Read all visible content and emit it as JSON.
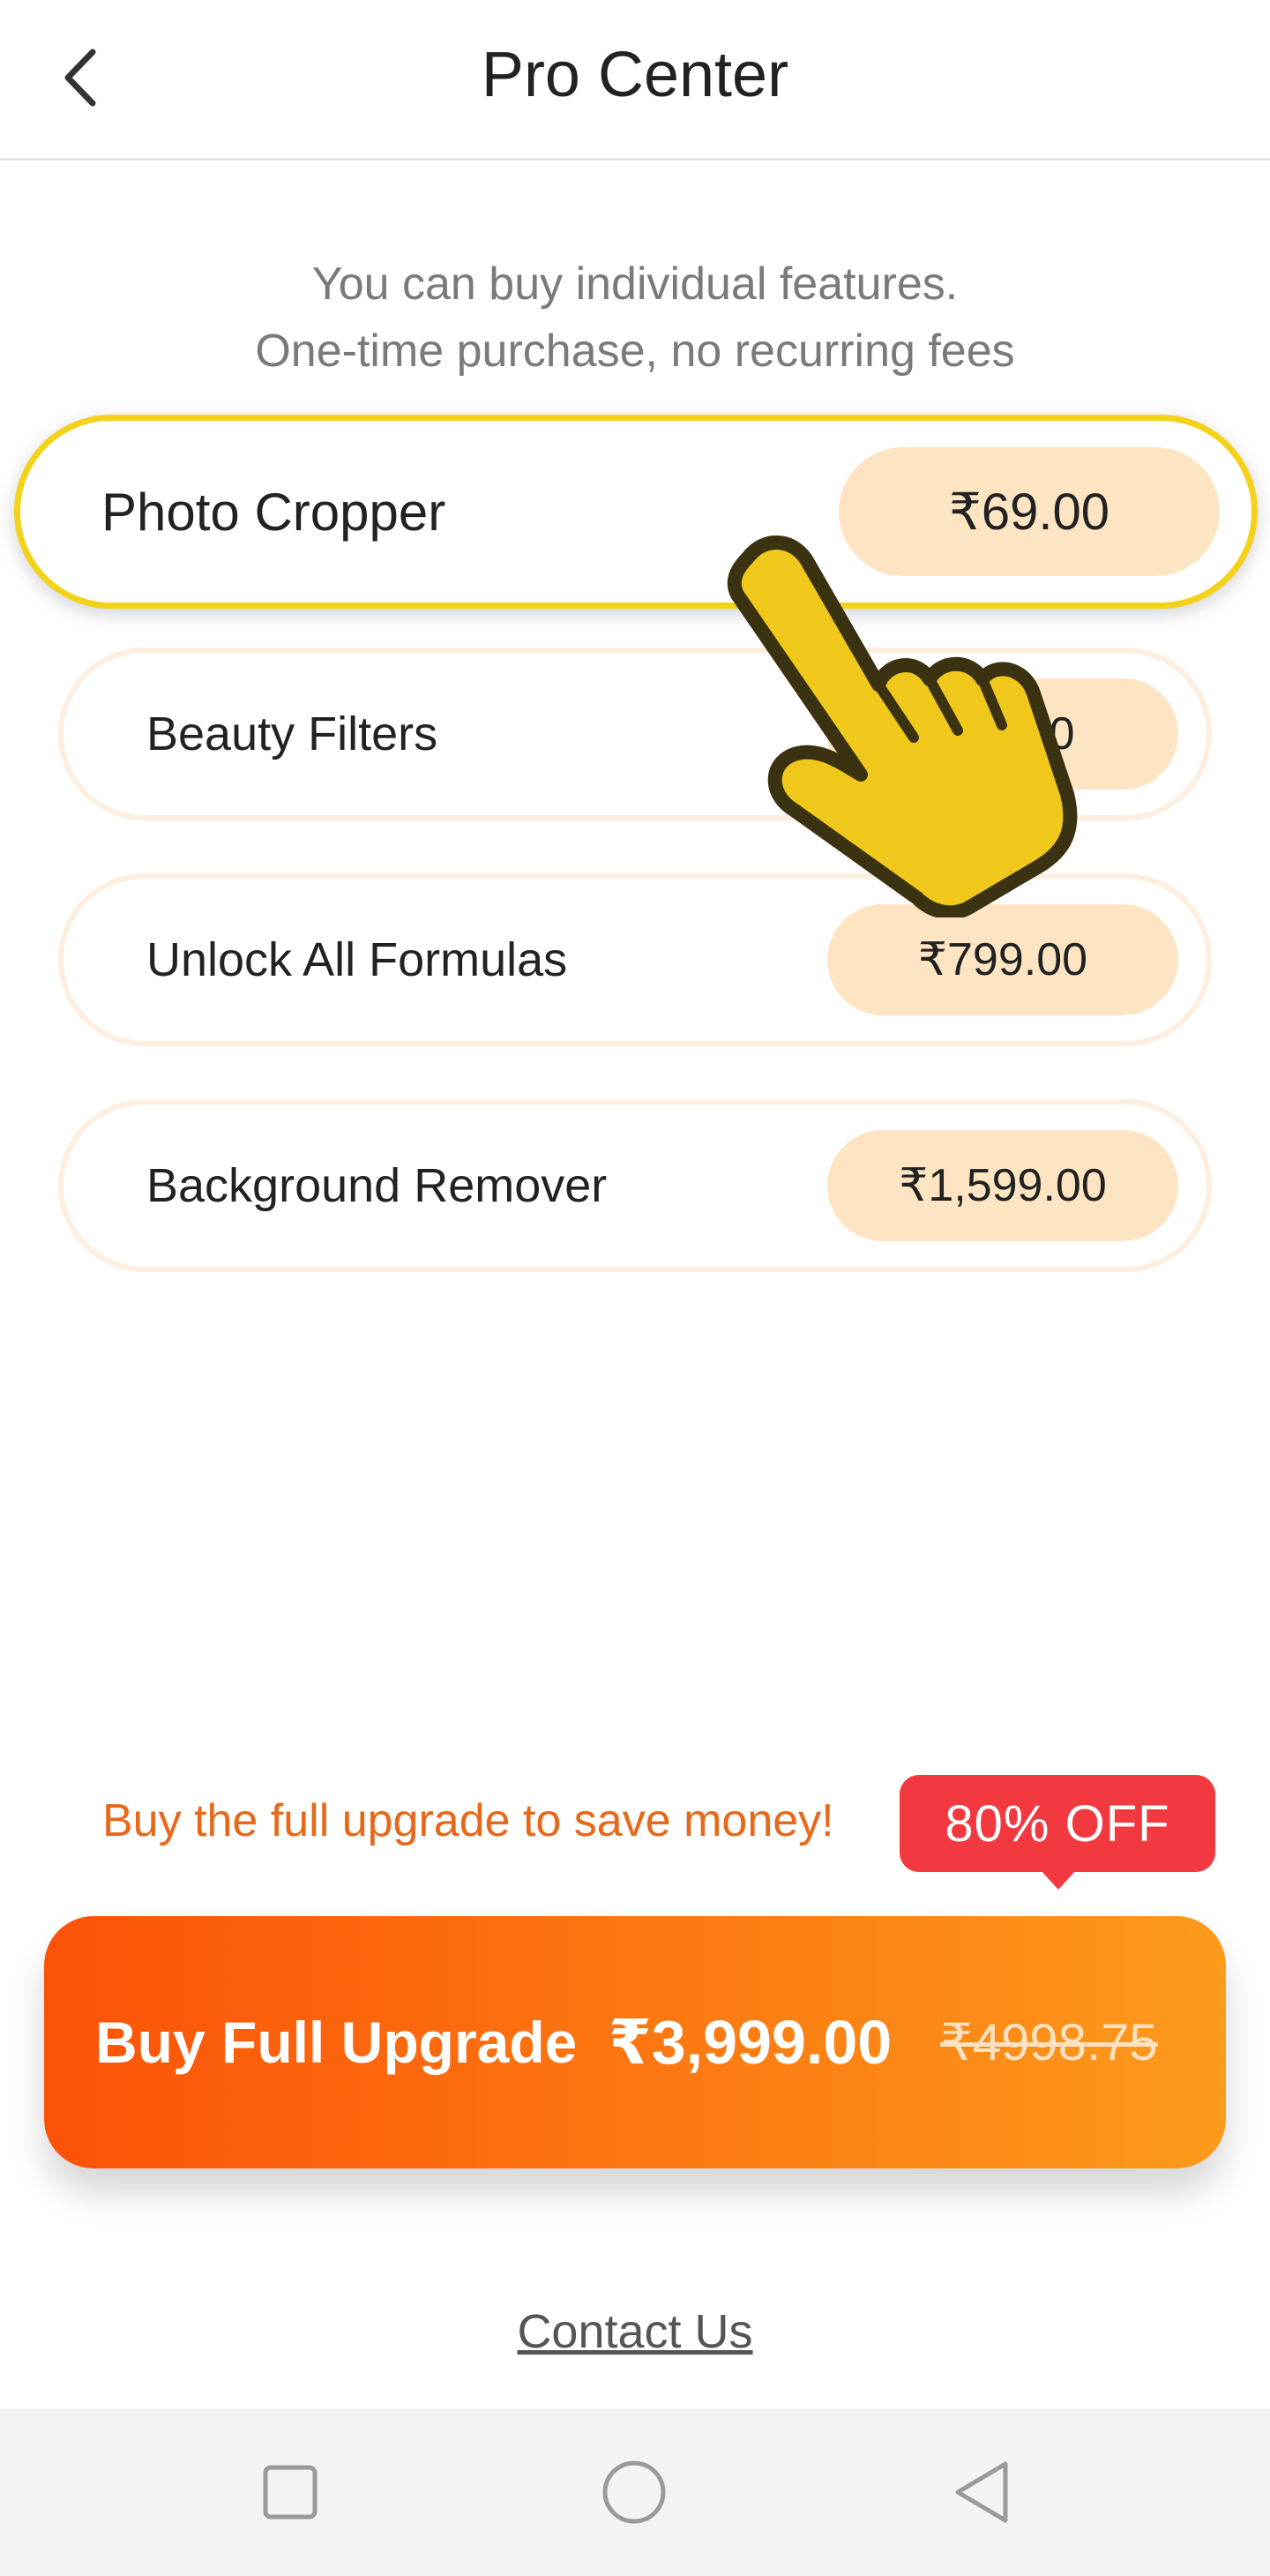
{
  "header": {
    "title": "Pro Center"
  },
  "subtitle": {
    "line1": "You can buy individual features.",
    "line2": "One-time purchase, no recurring fees"
  },
  "features": [
    {
      "label": "Photo Cropper",
      "price": "₹69.00",
      "selected": true
    },
    {
      "label": "Beauty Filters",
      "price": "₹69.00",
      "selected": false
    },
    {
      "label": "Unlock All Formulas",
      "price": "₹799.00",
      "selected": false
    },
    {
      "label": "Background Remover",
      "price": "₹1,599.00",
      "selected": false
    }
  ],
  "promo": {
    "text": "Buy the full upgrade to save money!",
    "badge": "80%  OFF"
  },
  "buy_button": {
    "label": "Buy Full Upgrade",
    "price": "₹3,999.00",
    "old_price": "₹4998.75"
  },
  "contact": {
    "label": "Contact Us"
  },
  "colors": {
    "accent_orange": "#fb5208",
    "accent_yellow": "#f4d21a",
    "badge_red": "#f2393f",
    "pill_bg": "#fde5c4"
  },
  "icons": [
    "back-chevron-icon",
    "hand-pointer-icon",
    "recents-square-icon",
    "home-circle-icon",
    "back-triangle-icon"
  ]
}
